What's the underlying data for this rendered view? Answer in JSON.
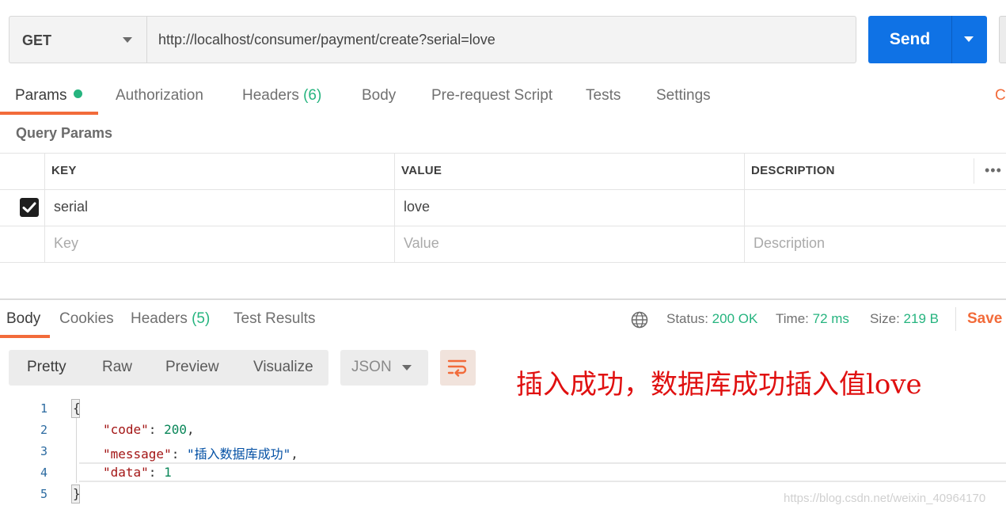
{
  "request": {
    "method": "GET",
    "url": "http://localhost/consumer/payment/create?serial=love",
    "send_label": "Send"
  },
  "request_tabs": {
    "params": "Params",
    "authorization": "Authorization",
    "headers": "Headers",
    "headers_count": "(6)",
    "body": "Body",
    "prerequest": "Pre-request Script",
    "tests": "Tests",
    "settings": "Settings",
    "cookies_clipped": "Co"
  },
  "query_params": {
    "title": "Query Params",
    "columns": [
      "KEY",
      "VALUE",
      "DESCRIPTION"
    ],
    "rows": [
      {
        "checked": true,
        "key": "serial",
        "value": "love",
        "description": ""
      }
    ],
    "placeholder": {
      "key": "Key",
      "value": "Value",
      "description": "Description"
    }
  },
  "response_tabs": {
    "body": "Body",
    "cookies": "Cookies",
    "headers": "Headers",
    "headers_count": "(5)",
    "test_results": "Test Results"
  },
  "response_meta": {
    "status_label": "Status:",
    "status_value": "200 OK",
    "time_label": "Time:",
    "time_value": "72 ms",
    "size_label": "Size:",
    "size_value": "219 B",
    "save_label": "Save I"
  },
  "format": {
    "modes": [
      "Pretty",
      "Raw",
      "Preview",
      "Visualize"
    ],
    "active": "Pretty",
    "language": "JSON"
  },
  "annotation": "插入成功，数据库成功插入值love",
  "code_lines": {
    "n1": "1",
    "n2": "2",
    "n3": "3",
    "n4": "4",
    "n5": "5",
    "open": "{",
    "code_key": "\"code\"",
    "code_val": "200",
    "message_key": "\"message\"",
    "message_val": "\"插入数据库成功\"",
    "data_key": "\"data\"",
    "data_val": "1",
    "close": "}"
  },
  "watermark": "https://blog.csdn.net/weixin_40964170",
  "colors": {
    "accent_orange": "#f26b3a",
    "send_blue": "#0f72e5",
    "status_green": "#26b47f",
    "annotation_red": "#e01010"
  }
}
